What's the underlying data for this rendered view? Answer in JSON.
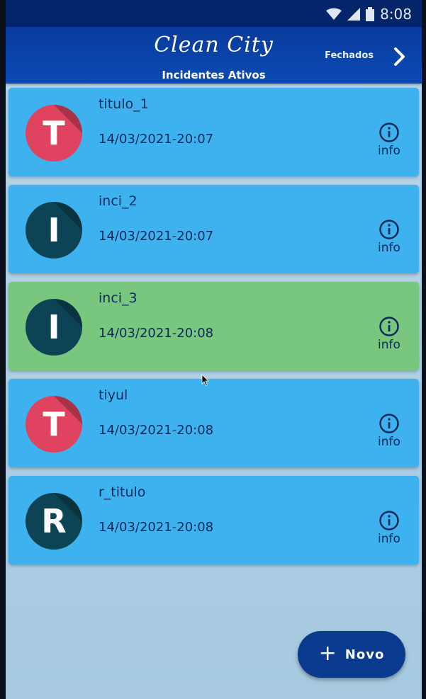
{
  "status_bar": {
    "time": "8:08"
  },
  "app_bar": {
    "title": "Clean City",
    "subtitle": "Incidentes Ativos",
    "closed_link": "Fechados"
  },
  "incidents": [
    {
      "title": "titulo_1",
      "datetime": "14/03/2021-20:07",
      "avatar_letter": "T",
      "avatar_color": "#e0435f",
      "card_color": "#3db2ee",
      "info_label": "info"
    },
    {
      "title": "inci_2",
      "datetime": "14/03/2021-20:07",
      "avatar_letter": "I",
      "avatar_color": "#0d4455",
      "card_color": "#3db2ee",
      "info_label": "info"
    },
    {
      "title": "inci_3",
      "datetime": "14/03/2021-20:08",
      "avatar_letter": "I",
      "avatar_color": "#0d4455",
      "card_color": "#79c67f",
      "info_label": "info"
    },
    {
      "title": "tiyul",
      "datetime": "14/03/2021-20:08",
      "avatar_letter": "T",
      "avatar_color": "#e0435f",
      "card_color": "#3db2ee",
      "info_label": "info"
    },
    {
      "title": "r_titulo",
      "datetime": "14/03/2021-20:08",
      "avatar_letter": "R",
      "avatar_color": "#0d4455",
      "card_color": "#3db2ee",
      "info_label": "info"
    }
  ],
  "fab": {
    "label": "Novo",
    "icon": "plus-icon"
  }
}
